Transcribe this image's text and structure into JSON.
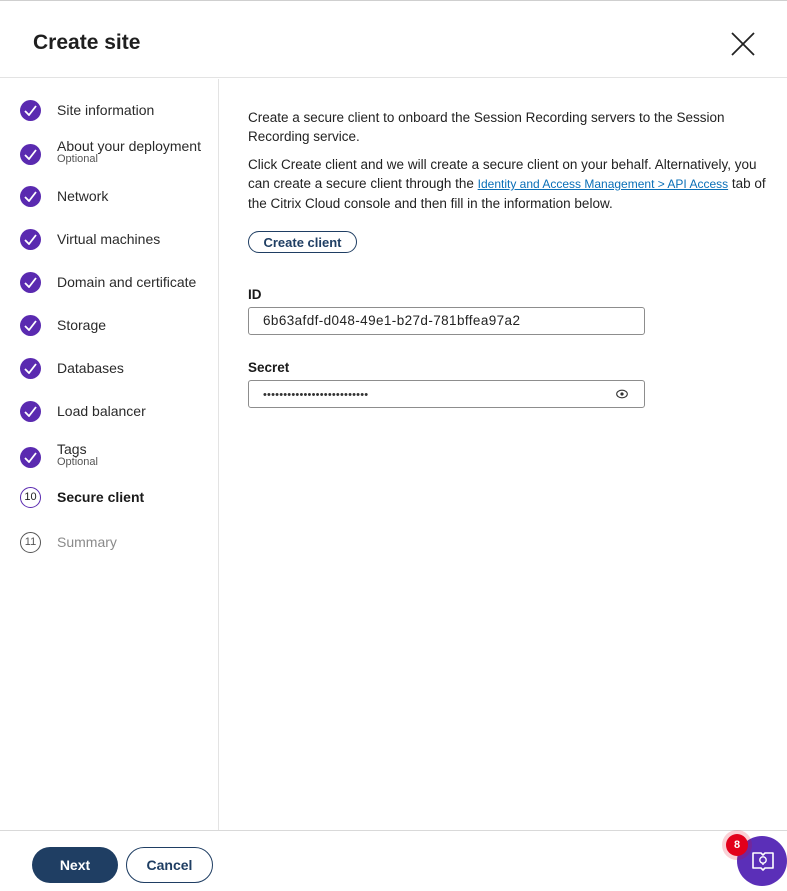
{
  "dialog": {
    "title": "Create site",
    "close_icon": "close-icon"
  },
  "steps": [
    {
      "label": "Site information",
      "status": "done"
    },
    {
      "label": "About your deployment",
      "sub": "Optional",
      "status": "done"
    },
    {
      "label": "Network",
      "status": "done"
    },
    {
      "label": "Virtual machines",
      "status": "done"
    },
    {
      "label": "Domain and certificate",
      "status": "done"
    },
    {
      "label": "Storage",
      "status": "done"
    },
    {
      "label": "Databases",
      "status": "done"
    },
    {
      "label": "Load balancer",
      "status": "done"
    },
    {
      "label": "Tags",
      "sub": "Optional",
      "status": "done"
    },
    {
      "label": "Secure client",
      "number": "10",
      "status": "current"
    },
    {
      "label": "Summary",
      "number": "11",
      "status": "pending"
    }
  ],
  "main": {
    "intro": "Create a secure client to onboard the Session Recording servers to the Session Recording service.",
    "instructions_before_link": "Click Create client and we will create a secure client on your behalf. Alternatively, you can create a secure client through the ",
    "link_text": "Identity and Access Management > API Access",
    "instructions_after_link": " tab of the Citrix Cloud console and then fill in the information below.",
    "create_client_label": "Create client",
    "id_label": "ID",
    "id_value": "6b63afdf-d048-49e1-b27d-781bffea97a2",
    "secret_label": "Secret",
    "secret_value": "••••••••••••••••••••••••••",
    "secret_toggle_icon": "eye-icon"
  },
  "footer": {
    "next_label": "Next",
    "cancel_label": "Cancel"
  },
  "help": {
    "badge_count": "8",
    "icon": "help-book-icon"
  },
  "colors": {
    "accent": "#5a2ab0",
    "primary_button": "#1f3e63",
    "link": "#0a6fb7",
    "badge": "#e3001b"
  }
}
